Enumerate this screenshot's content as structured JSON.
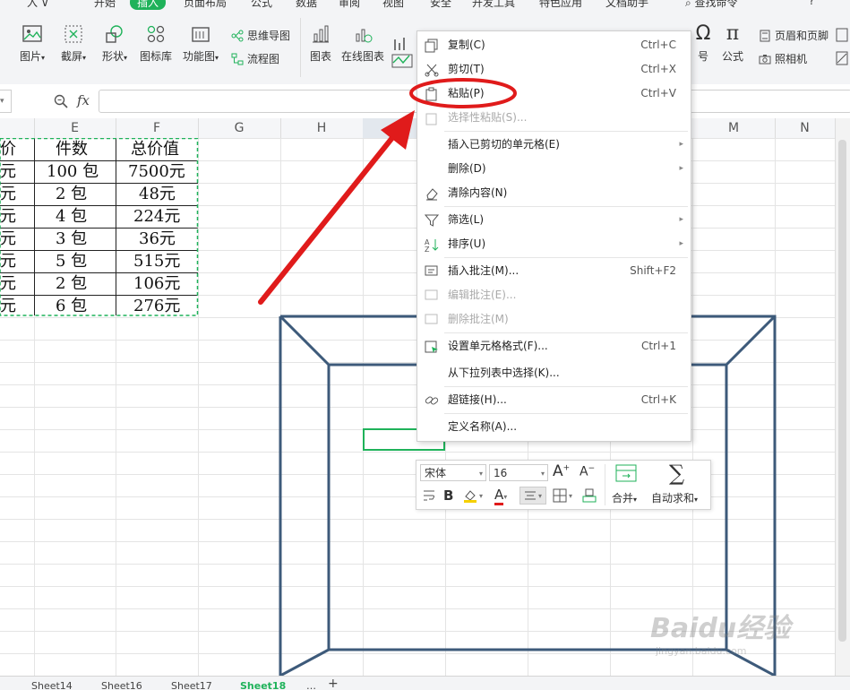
{
  "ribbon": {
    "tabs": [
      "开始",
      "插入",
      "页面布局",
      "公式",
      "数据",
      "审阅",
      "视图",
      "安全",
      "开发工具",
      "特色应用",
      "文档助手"
    ],
    "active_tab": "插入",
    "search_placeholder": "查找命令",
    "help": "?",
    "items": {
      "picture": "图片",
      "screenshot": "截屏",
      "shapes": "形状",
      "icon_library": "图标库",
      "function_chart": "功能图",
      "mind_map": "思维导图",
      "flowchart": "流程图",
      "chart": "图表",
      "online_chart": "在线图表",
      "symbol": "符号",
      "formula": "公式",
      "header_footer": "页眉和页脚",
      "camera": "照相机"
    }
  },
  "formula_bar": {
    "fx": "fx",
    "value": ""
  },
  "columns": [
    "E",
    "F",
    "G",
    "H",
    "M",
    "N"
  ],
  "table": {
    "header": [
      "价",
      "件数",
      "总价值"
    ],
    "rows": [
      [
        "元",
        "100 包",
        "7500元"
      ],
      [
        "元",
        "2 包",
        "48元"
      ],
      [
        "元",
        "4 包",
        "224元"
      ],
      [
        "元",
        "3 包",
        "36元"
      ],
      [
        "元",
        "5 包",
        "515元"
      ],
      [
        "元",
        "2 包",
        "106元"
      ],
      [
        "元",
        "6 包",
        "276元"
      ]
    ]
  },
  "context_menu": {
    "items": [
      {
        "label": "复制(C)",
        "shortcut": "Ctrl+C",
        "icon": "copy-icon",
        "disabled": false
      },
      {
        "label": "剪切(T)",
        "shortcut": "Ctrl+X",
        "icon": "scissors-icon",
        "disabled": false
      },
      {
        "label": "粘贴(P)",
        "shortcut": "Ctrl+V",
        "icon": "paste-icon",
        "disabled": false
      },
      {
        "label": "选择性粘贴(S)...",
        "shortcut": "",
        "icon": "paste-special-icon",
        "disabled": true
      },
      {
        "label": "插入已剪切的单元格(E)",
        "shortcut": "",
        "icon": "",
        "disabled": false,
        "submenu": true
      },
      {
        "label": "删除(D)",
        "shortcut": "",
        "icon": "",
        "disabled": false,
        "submenu": true
      },
      {
        "label": "清除内容(N)",
        "shortcut": "",
        "icon": "eraser-icon",
        "disabled": false
      },
      {
        "label": "筛选(L)",
        "shortcut": "",
        "icon": "filter-icon",
        "disabled": false,
        "submenu": true
      },
      {
        "label": "排序(U)",
        "shortcut": "",
        "icon": "sort-icon",
        "disabled": false,
        "submenu": true
      },
      {
        "label": "插入批注(M)...",
        "shortcut": "Shift+F2",
        "icon": "comment-add-icon",
        "disabled": false
      },
      {
        "label": "编辑批注(E)...",
        "shortcut": "",
        "icon": "comment-edit-icon",
        "disabled": true
      },
      {
        "label": "删除批注(M)",
        "shortcut": "",
        "icon": "comment-delete-icon",
        "disabled": true
      },
      {
        "label": "设置单元格格式(F)...",
        "shortcut": "Ctrl+1",
        "icon": "format-cells-icon",
        "disabled": false
      },
      {
        "label": "从下拉列表中选择(K)...",
        "shortcut": "",
        "icon": "",
        "disabled": false
      },
      {
        "label": "超链接(H)...",
        "shortcut": "Ctrl+K",
        "icon": "link-icon",
        "disabled": false
      },
      {
        "label": "定义名称(A)...",
        "shortcut": "",
        "icon": "",
        "disabled": false
      }
    ]
  },
  "mini_toolbar": {
    "font": "宋体",
    "size": "16",
    "bold": "B",
    "text_color_letter": "A",
    "grow": "A",
    "shrink": "A",
    "merge": "合并",
    "autosum": "自动求和"
  },
  "sheets": [
    "Sheet14",
    "Sheet16",
    "Sheet17",
    "Sheet18"
  ],
  "active_sheet": "Sheet18",
  "watermark": {
    "brand": "Baidu经验",
    "url": "jingyan.baidu.com"
  },
  "colors": {
    "accent": "#1fb25a",
    "annotation_red": "#e01b1b",
    "frame_blue": "#3d5a7a"
  }
}
